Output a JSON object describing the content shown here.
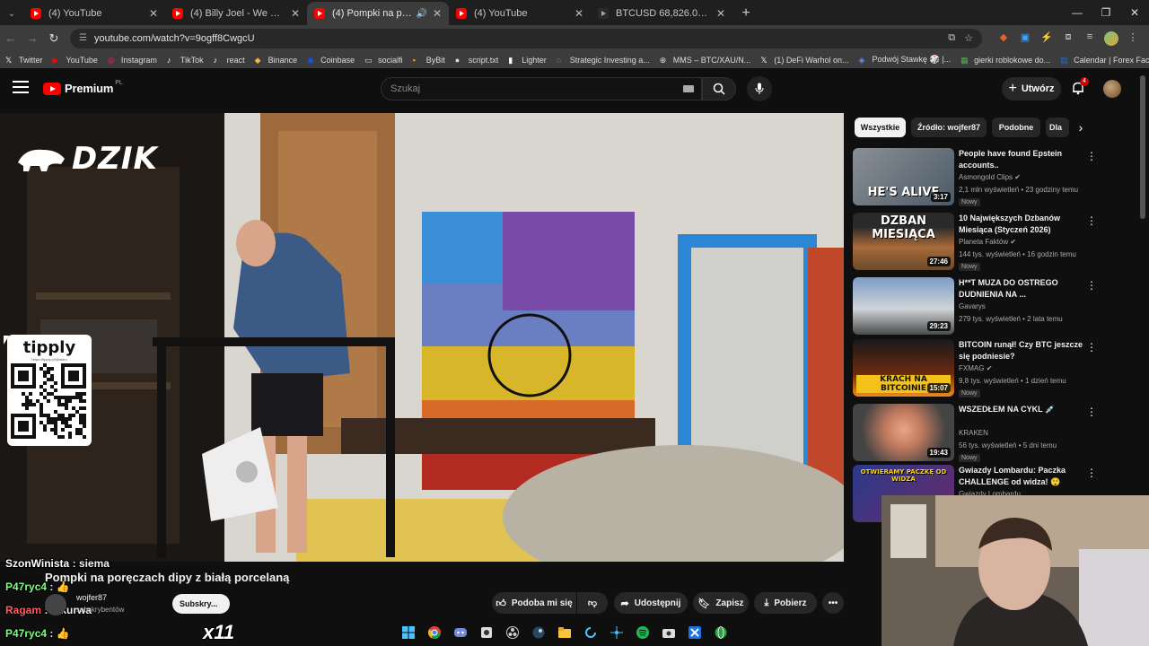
{
  "browser": {
    "tabs": [
      {
        "title": "(4) YouTube",
        "icon": "youtube-icon",
        "active": false
      },
      {
        "title": "(4) Billy Joel - We Didn't Start The Fire",
        "icon": "youtube-icon",
        "active": false
      },
      {
        "title": "(4) Pompki na poręczach dipy z białą porcelaną",
        "icon": "youtube-icon",
        "active": true
      },
      {
        "title": "(4) YouTube",
        "icon": "youtube-icon",
        "active": false
      },
      {
        "title": "BTCUSD 68,826.07 ▼ −2.3% Bearish",
        "icon": "tradingview-icon",
        "active": false
      }
    ],
    "url": "youtube.com/watch?v=9ogff8CwgcU",
    "bookmarks": [
      {
        "label": "Twitter",
        "color": "#ffffff",
        "glyph": "𝕏"
      },
      {
        "label": "YouTube",
        "color": "#ff0000",
        "glyph": "▶"
      },
      {
        "label": "Instagram",
        "color": "#e1306c",
        "glyph": "◎"
      },
      {
        "label": "TikTok",
        "color": "#ffffff",
        "glyph": "♪"
      },
      {
        "label": "react",
        "color": "#ffffff",
        "glyph": "♪"
      },
      {
        "label": "Binance",
        "color": "#f3ba2f",
        "glyph": "◆"
      },
      {
        "label": "Coinbase",
        "color": "#1652f0",
        "glyph": "◉"
      },
      {
        "label": "socialfi",
        "color": "#dddddd",
        "glyph": "▭"
      },
      {
        "label": "ByBit",
        "color": "#f7a600",
        "glyph": "▪"
      },
      {
        "label": "script.txt",
        "color": "#dddddd",
        "glyph": "●"
      },
      {
        "label": "Lighter",
        "color": "#ffffff",
        "glyph": "▮"
      },
      {
        "label": "Strategic Investing a...",
        "color": "#dddddd",
        "glyph": "◌"
      },
      {
        "label": "MMS – BTC/XAU/N...",
        "color": "#dddddd",
        "glyph": "⊕"
      },
      {
        "label": "(1) DeFi Warhol on...",
        "color": "#ffffff",
        "glyph": "𝕏"
      },
      {
        "label": "Podwój Stawkę 🎲 |...",
        "color": "#6b8cff",
        "glyph": "◈"
      },
      {
        "label": "gierki roblokowe do...",
        "color": "#4caf50",
        "glyph": "▦"
      },
      {
        "label": "Calendar | Forex Fac...",
        "color": "#2a6cc0",
        "glyph": "▤"
      }
    ]
  },
  "youtube": {
    "logo_text": "Premium",
    "logo_region": "PL",
    "search_placeholder": "Szukaj",
    "create_label": "Utwórz",
    "notifications_count": "4",
    "filters": [
      {
        "label": "Wszystkie",
        "active": true
      },
      {
        "label": "Źródło: wojfer87",
        "active": false
      },
      {
        "label": "Podobne",
        "active": false
      },
      {
        "label": "Dla",
        "active": false
      }
    ],
    "video": {
      "title": "Pompki na poręczach dipy z białą porcelaną",
      "channel": "wojfer87",
      "subscribers": "subskrybentów",
      "subscribe_label": "Subskry..."
    },
    "actions": [
      {
        "label": "Podoba mi się",
        "icon": "thumb-up-icon"
      },
      {
        "label": "",
        "icon": "thumb-down-icon"
      },
      {
        "label": "Udostępnij",
        "icon": "share-icon"
      },
      {
        "label": "Zapisz",
        "icon": "bookmark-icon"
      },
      {
        "label": "Pobierz",
        "icon": "download-icon"
      },
      {
        "label": "•••",
        "icon": "more-icon"
      }
    ],
    "recommendations": [
      {
        "title": "People have found Epstein accounts..",
        "channel": "Asmongold Clips",
        "verified": true,
        "meta": "2,1 mln wyświetleń • 23 godziny temu",
        "badge": "Nowy",
        "duration": "3:17",
        "caption": "HE'S ALIVE"
      },
      {
        "title": "10 Największych Dzbanów Miesiąca (Styczeń 2026)",
        "channel": "Planeta Faktów",
        "verified": true,
        "meta": "144 tys. wyświetleń • 16 godzin temu",
        "badge": "Nowy",
        "duration": "27:46",
        "caption": "DZBAN MIESIĄCA"
      },
      {
        "title": "H**T MUZA DO OSTREGO DUDNIENIA NA ...",
        "channel": "Gavarys",
        "verified": false,
        "meta": "279 tys. wyświetleń • 2 lata temu",
        "badge": "",
        "duration": "29:23",
        "caption": ""
      },
      {
        "title": "BITCOIN runął! Czy BTC jeszcze się podniesie?",
        "channel": "FXMAG",
        "verified": true,
        "meta": "9,8 tys. wyświetleń • 1 dzień temu",
        "badge": "Nowy",
        "duration": "15:07",
        "caption": "KRACH NA BITCOINIE"
      },
      {
        "title": "WSZEDŁEM NA CYKL 💉",
        "channel": "KRAKEN",
        "verified": false,
        "meta": "56 tys. wyświetleń • 5 dni temu",
        "badge": "Nowy",
        "duration": "19:43",
        "caption": ""
      },
      {
        "title": "Gwiazdy Lombardu: Paczka CHALLENGE od widza! 😲",
        "channel": "Gwiazdy Lombardu",
        "verified": false,
        "meta": "",
        "badge": "",
        "duration": "",
        "caption": "OTWIERAMY PACZKĘ OD WIDZA"
      }
    ]
  },
  "overlay": {
    "brand": "DZIK",
    "tipply_title": "tipply",
    "tipply_url": "https://tipply.pl/@astro",
    "chat": [
      {
        "user": "SzonWinista",
        "msg": "siema",
        "color": "#ffffff"
      },
      {
        "user": "P47ryc4",
        "msg": "👍",
        "color": "#7fff7f"
      },
      {
        "user": "Ragam",
        "msg": "o kurwa",
        "color": "#ff5f5f"
      },
      {
        "user": "P47ryc4",
        "msg": "👍",
        "color": "#7fff7f"
      }
    ],
    "x_count": "x11"
  }
}
